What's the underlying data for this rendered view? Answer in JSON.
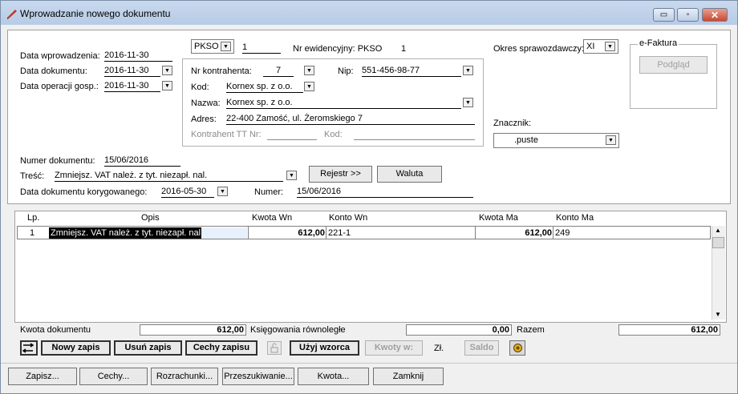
{
  "window": {
    "title": "Wprowadzanie nowego dokumentu",
    "controls": {
      "min": "▭",
      "max": "▫",
      "close": "✕"
    }
  },
  "dates": {
    "entry_label": "Data wprowadzenia:",
    "entry_value": "2016-11-30",
    "doc_label": "Data dokumentu:",
    "doc_value": "2016-11-30",
    "op_label": "Data operacji gosp.:",
    "op_value": "2016-11-30"
  },
  "register": {
    "code": "PKSO",
    "number": "1",
    "evidence_label": "Nr ewidencyjny: PKSO",
    "evidence_number": "1"
  },
  "contractor": {
    "nr_label": "Nr kontrahenta:",
    "nr_value": "7",
    "nip_label": "Nip:",
    "nip_value": "551-456-98-77",
    "code_label": "Kod:",
    "code_value": "Kornex sp. z o.o.",
    "name_label": "Nazwa:",
    "name_value": "Kornex sp. z o.o.",
    "address_label": "Adres:",
    "address_value": "22-400 Zamość, ul. Żeromskiego 7",
    "tt_label": "Kontrahent TT Nr:",
    "tt_code_label": "Kod:"
  },
  "period": {
    "label": "Okres sprawozdawczy:",
    "value": "XI"
  },
  "efaktura": {
    "title": "e-Faktura",
    "preview": "Podgląd"
  },
  "marker": {
    "label": "Znacznik:",
    "value": ".puste"
  },
  "document": {
    "number_label": "Numer dokumentu:",
    "number_value": "15/06/2016",
    "content_label": "Treść:",
    "content_value": "Zmniejsz. VAT należ. z tyt. niezapł. nal.",
    "register_btn": "Rejestr >>",
    "currency_btn": "Waluta",
    "corrected_label": "Data dokumentu korygowanego:",
    "corrected_value": "2016-05-30",
    "numer_label": "Numer:",
    "numer_value": "15/06/2016"
  },
  "grid": {
    "headers": {
      "lp": "Lp.",
      "opis": "Opis",
      "kwota_wn": "Kwota  Wn",
      "konto_wn": "Konto  Wn",
      "kwota_ma": "Kwota Ma",
      "konto_ma": "Konto Ma"
    },
    "rows": [
      {
        "lp": "1",
        "opis": "Zmniejsz. VAT należ. z tyt. niezapł. nal.",
        "kwota_wn": "612,00",
        "konto_wn": "221-1",
        "kwota_ma": "612,00",
        "konto_ma": "249"
      }
    ]
  },
  "summary": {
    "doc_amount_label": "Kwota dokumentu",
    "doc_amount": "612,00",
    "parallel_label": "Księgowania równoległe",
    "parallel_amount": "0,00",
    "total_label": "Razem",
    "total_amount": "612,00"
  },
  "toolbar": {
    "new_entry": "Nowy zapis",
    "delete_entry": "Usuń zapis",
    "features": "Cechy zapisu",
    "use_template": "Użyj wzorca",
    "amounts": "Kwoty w:",
    "currency": "Zł.",
    "balance": "Saldo"
  },
  "bottom": {
    "save": "Zapisz...",
    "features": "Cechy...",
    "settlements": "Rozrachunki...",
    "search": "Przeszukiwanie...",
    "amount": "Kwota...",
    "close": "Zamknij"
  },
  "colors": {
    "title_bar": "#c4d5ec",
    "selection": "#000000",
    "grid_bg": "#ffffff"
  }
}
